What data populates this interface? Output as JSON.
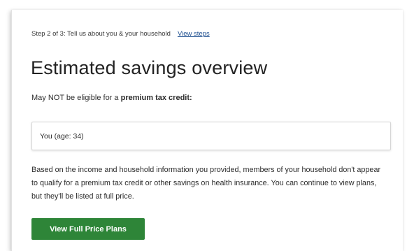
{
  "header": {
    "step_text": "Step 2 of 3: Tell us about you & your household",
    "view_steps_link": "View steps"
  },
  "main": {
    "title": "Estimated savings overview",
    "eligibility_prefix": "May NOT be eligible for a",
    "eligibility_bold": "premium tax credit:",
    "persons": [
      {
        "label": "You (age: 34)"
      }
    ],
    "explanation": "Based on the income and household information you provided, members of your household don't appear to qualify for a premium tax credit or other savings on health insurance. You can continue to view plans, but they'll be listed at full price.",
    "cta_label": "View Full Price Plans"
  },
  "colors": {
    "cta_background": "#2e8538",
    "link": "#1d4e8f"
  }
}
